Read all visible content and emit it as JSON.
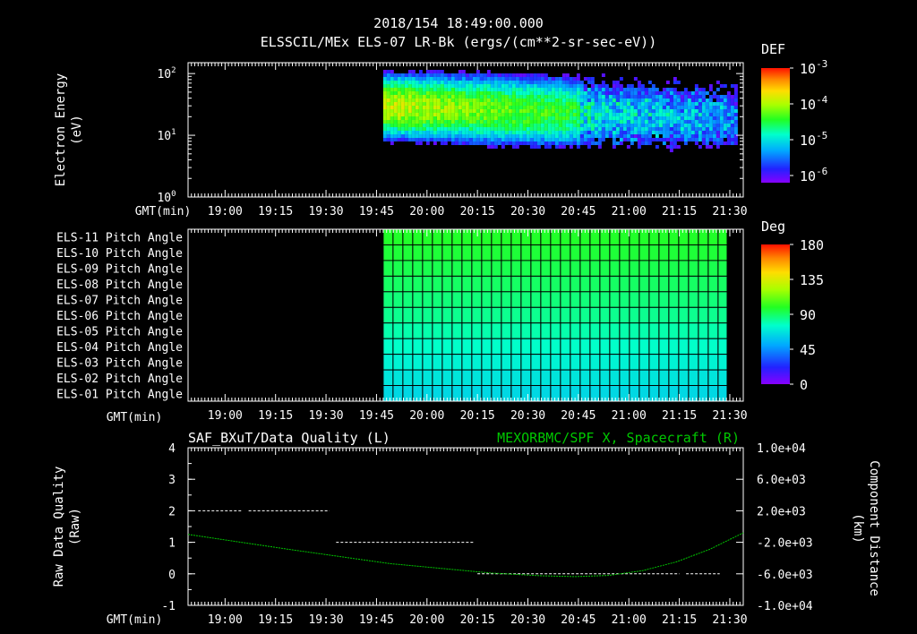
{
  "header": {
    "title": "2018/154 18:49:00.000",
    "subtitle": "ELSSCIL/MEx ELS-07 LR-Bk  (ergs/(cm**2-sr-sec-eV))"
  },
  "colors": {
    "background": "#000000",
    "foreground": "#ffffff",
    "spacecraft_line": "#00c800",
    "quality_line": "#ffffff"
  },
  "time_axis": {
    "label": "GMT(min)",
    "ticks": [
      "19:00",
      "19:15",
      "19:30",
      "19:45",
      "20:00",
      "20:15",
      "20:30",
      "20:45",
      "21:00",
      "21:15",
      "21:30"
    ],
    "range_min": [
      0,
      165
    ],
    "tick_minutes": [
      11,
      26,
      41,
      56,
      71,
      86,
      101,
      116,
      131,
      146,
      161
    ],
    "data_start_min": 58,
    "data_end_min": 163
  },
  "chart_data": [
    {
      "type": "heatmap",
      "name": "electron-energy-spectrogram",
      "ylabel": "Electron Energy (eV)",
      "yscale": "log",
      "ylim": [
        1,
        150
      ],
      "y_ticks": [
        {
          "base": "10",
          "exp": "0"
        },
        {
          "base": "10",
          "exp": "1"
        },
        {
          "base": "10",
          "exp": "2"
        }
      ],
      "colorbar": {
        "label": "DEF",
        "ticks": [
          {
            "base": "10",
            "exp": "-3"
          },
          {
            "base": "10",
            "exp": "-4"
          },
          {
            "base": "10",
            "exp": "-5"
          },
          {
            "base": "10",
            "exp": "-6"
          }
        ],
        "log_range": [
          -6.2,
          -3.0
        ]
      }
    },
    {
      "type": "heatmap",
      "name": "pitch-angle-panel",
      "rows": [
        "ELS-11 Pitch Angle",
        "ELS-10 Pitch Angle",
        "ELS-09 Pitch Angle",
        "ELS-08 Pitch Angle",
        "ELS-07 Pitch Angle",
        "ELS-06 Pitch Angle",
        "ELS-05 Pitch Angle",
        "ELS-04 Pitch Angle",
        "ELS-03 Pitch Angle",
        "ELS-02 Pitch Angle",
        "ELS-01 Pitch Angle"
      ],
      "row_values_deg": [
        98,
        96,
        93,
        90,
        87,
        84,
        80,
        76,
        72,
        68,
        64
      ],
      "colorbar": {
        "label": "Deg",
        "ticks": [
          "180",
          "135",
          "90",
          "45",
          "0"
        ],
        "range": [
          0,
          180
        ]
      }
    },
    {
      "type": "line",
      "name": "quality-and-position",
      "left_title": "SAF_BXuT/Data Quality (L)",
      "right_title": "MEXORBMC/SPF X, Spacecraft (R)",
      "ylabel_left": "Raw Data Quality (Raw)",
      "ylabel_right": "Component Distance (km)",
      "ylim_left": [
        -1,
        4
      ],
      "y_ticks_left": [
        "-1",
        "0",
        "1",
        "2",
        "3",
        "4"
      ],
      "ylim_right": [
        -10000,
        10000
      ],
      "y_ticks_right": [
        "-1.0e+04",
        "-6.0e+03",
        "-2.0e+03",
        "2.0e+03",
        "6.0e+03",
        "1.0e+04"
      ],
      "series": [
        {
          "axis": "left",
          "x_min": [
            3,
            16
          ],
          "y": 2
        },
        {
          "axis": "left",
          "x_min": [
            18,
            42
          ],
          "y": 2
        },
        {
          "axis": "left",
          "x_min": [
            44,
            85
          ],
          "y": 1
        },
        {
          "axis": "left",
          "x_min": [
            86,
            146
          ],
          "y": 0
        },
        {
          "axis": "left",
          "x_min": [
            148,
            158
          ],
          "y": 0
        },
        {
          "axis": "right",
          "x_min": [
            0,
            30,
            60,
            90,
            105,
            115,
            125,
            135,
            145,
            155,
            165
          ],
          "y": [
            -1000,
            -2900,
            -4700,
            -5900,
            -6250,
            -6350,
            -6200,
            -5600,
            -4500,
            -2900,
            -800
          ]
        }
      ]
    }
  ]
}
